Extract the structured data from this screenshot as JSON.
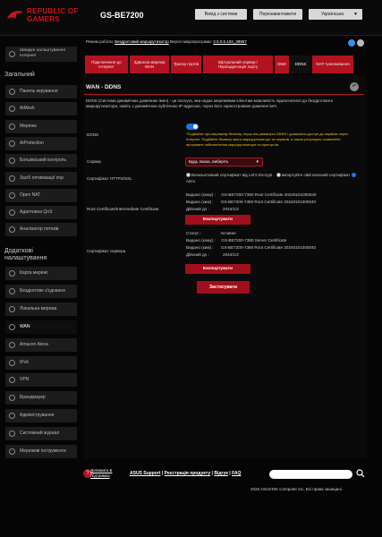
{
  "header": {
    "brand_line1": "REPUBLIC OF",
    "brand_line2": "GAMERS",
    "model": "GS-BE7200",
    "logout_label": "Вихід з системи",
    "reboot_label": "Перезавантажити",
    "language": "Українська"
  },
  "info": {
    "mode_prefix": "Режим роботи:",
    "mode_value": "Бездротовий маршрутизатор",
    "firmware_prefix": "Версія мікропрограми:",
    "firmware_value": "3.0.0.6.102_38957"
  },
  "sidebar": {
    "setup_label_line1": "Швидке налаштування",
    "setup_label_line2": "Інтернет",
    "general_heading": "Загальний",
    "general_items": [
      {
        "label": "Панель керування",
        "icon": "dashboard-icon"
      },
      {
        "label": "AiMesh",
        "icon": "mesh-icon"
      },
      {
        "label": "Мережа",
        "icon": "network-icon"
      },
      {
        "label": "AiProtection",
        "icon": "shield-icon"
      },
      {
        "label": "Батьківський контроль",
        "icon": "parental-icon"
      },
      {
        "label": "Засіб оптимізації ігор",
        "icon": "game-icon"
      },
      {
        "label": "Open NAT",
        "icon": "nat-icon"
      },
      {
        "label": "Адаптивна QoS",
        "icon": "qos-icon"
      },
      {
        "label": "Аналізатор потоків",
        "icon": "traffic-icon"
      }
    ],
    "advanced_heading_line1": "Додаткові",
    "advanced_heading_line2": "налаштування",
    "advanced_items": [
      {
        "label": "Карта мережі",
        "icon": "map-icon"
      },
      {
        "label": "Бездротове з'єднання",
        "icon": "wireless-icon"
      },
      {
        "label": "Локальна мережа",
        "icon": "lan-icon"
      },
      {
        "label": "WAN",
        "icon": "wan-icon"
      },
      {
        "label": "Amazon Alexa",
        "icon": "alexa-icon"
      },
      {
        "label": "IPv6",
        "icon": "ipv6-icon"
      },
      {
        "label": "VPN",
        "icon": "vpn-icon"
      },
      {
        "label": "Брандмауер",
        "icon": "firewall-icon"
      },
      {
        "label": "Адміністрування",
        "icon": "admin-icon"
      },
      {
        "label": "Системний журнал",
        "icon": "log-icon"
      },
      {
        "label": "Мережеві інструменти",
        "icon": "tools-icon"
      }
    ]
  },
  "tabs": [
    {
      "label": "Підключення до Інтернет"
    },
    {
      "label": "Здвоєна мережа WAN"
    },
    {
      "label": "Тригер портів"
    },
    {
      "label": "Віртуальний сервер / Переадресація порту"
    },
    {
      "label": "DMZ"
    },
    {
      "label": "DDNS"
    },
    {
      "label": "NAT-тунелювання"
    }
  ],
  "panel": {
    "title": "WAN - DDNS",
    "description": "DDNS (Система динамічних доменних імен) - це послуга, яка надає мережевим клієнтам можливість підключатися до бездротового маршрутизатора, навіть з динамічною публічною IP-адресою, через його зареєстроване доменне ім'я.",
    "ddns_label": "DDNS",
    "ddns_enabled": true,
    "warning": "*Подбайте про мережеву безпеку, перш ніж увімкнути DDNS і дозволити доступ до сервісів через Інтернет. Подбайте безпеку свого маршрутизатора та сервісів, а також регулярно оновлюйте програмне забезпечення маршрутизатора та пристроїв.",
    "server_label": "Сервер",
    "server_value": "Будь ласка, виберіть",
    "https_label": "Сертифікат HTTPS/SSL",
    "https_opt1": "Безкоштовний сертифікат від Let's Encrypt",
    "https_opt2": "Імпортуйте свій власний сертифікат",
    "https_opt3": "Авто",
    "root_label": "Root Certificate/Intermediate Certificate",
    "root_issued_to_label": "Видано (кому) :",
    "root_issued_to": "GS-BE7200-7380 Root Certificate 20240101000040",
    "root_issued_by_label": "Видано (ким) :",
    "root_issued_by": "GS-BE7200-7380 Root Certificate 20240101000040",
    "root_valid_label": "Дійсний до :",
    "root_valid": "2044/1/2",
    "export_label": "Експортувати",
    "server_cert_label": "Сертифікат сервера",
    "status_label": "Статус :",
    "status_value": "Активне",
    "srv_issued_to_label": "Видано (кому) :",
    "srv_issued_to": "GS-BE7200-7380 Server Certificate",
    "srv_issued_by_label": "Видано (ким) :",
    "srv_issued_by": "GS-BE7200-7380 Root Certificate 20240101000040",
    "srv_valid_label": "Дійсний до :",
    "srv_valid": "2044/1/2",
    "apply_label": "Застосувати"
  },
  "footer": {
    "help_line1": "Допомога &",
    "help_line2": "Підтримка",
    "link1": "ASUS Support",
    "link2": "Реєстрація продукту",
    "link3": "Відгук",
    "link4": "FAQ",
    "copyright": "2026 ASUSTeK Computer Inc. Всі права захищені."
  },
  "colors": {
    "accent": "#b31221",
    "toggle": "#1a73e8",
    "warning": "#e8c31a"
  }
}
